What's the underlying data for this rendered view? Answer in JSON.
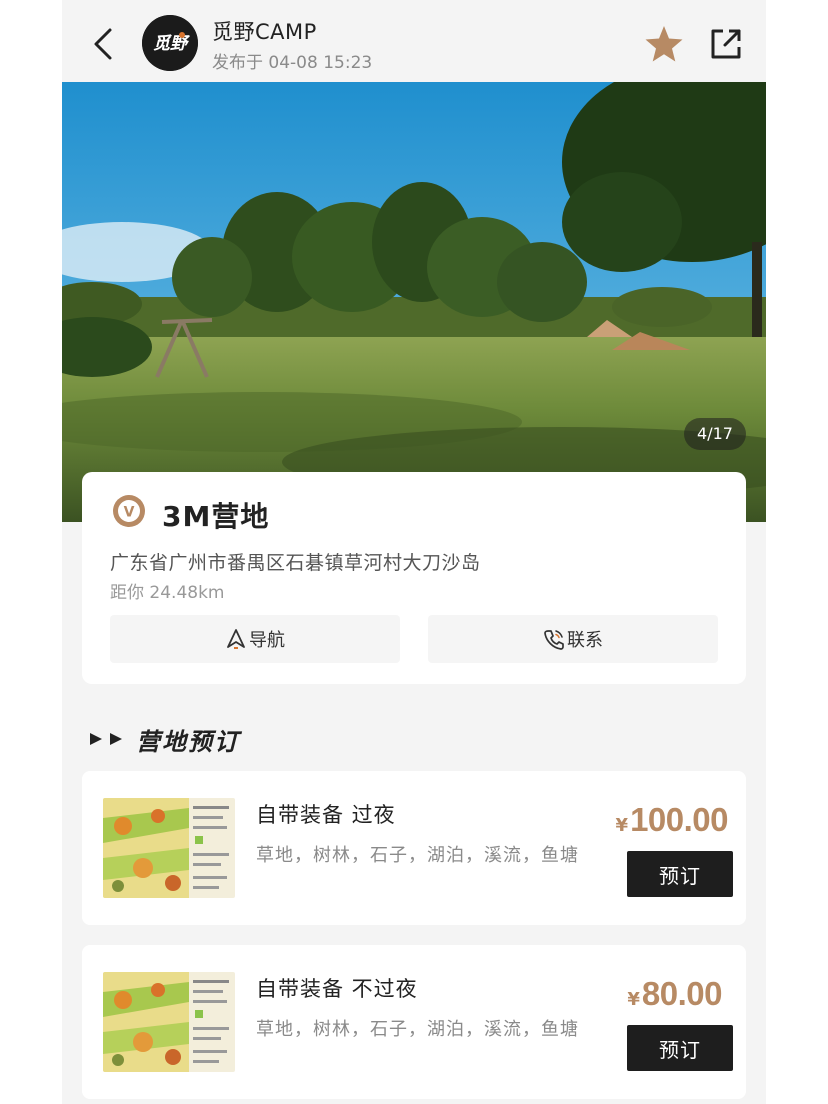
{
  "header": {
    "author_name": "觅野CAMP",
    "post_time": "发布于 04-08 15:23",
    "avatar_text": "觅野",
    "icons": {
      "back": "chevron-left-icon",
      "favorite": "star-icon",
      "share": "share-icon"
    },
    "star_color": "#b78a64"
  },
  "hero": {
    "page_indicator": "4/17"
  },
  "camp": {
    "name": "3M营地",
    "address": "广东省广州市番禺区石碁镇草河村大刀沙岛",
    "distance": "距你 24.48km",
    "nav_label": "导航",
    "contact_label": "联系",
    "badge_letter": "V",
    "badge_color": "#b78a64"
  },
  "section": {
    "title": "营地预订"
  },
  "products": [
    {
      "title": "自带装备 过夜",
      "tags": "草地，树林，石子，湖泊，溪流，鱼塘",
      "currency": "¥",
      "price": "100.00",
      "button": "预订"
    },
    {
      "title": "自带装备 不过夜",
      "tags": "草地，树林，石子，湖泊，溪流，鱼塘",
      "currency": "¥",
      "price": "80.00",
      "button": "预订"
    }
  ],
  "colors": {
    "accent": "#b78a64",
    "button_dark": "#1e1e1e",
    "background": "#f4f4f4"
  }
}
